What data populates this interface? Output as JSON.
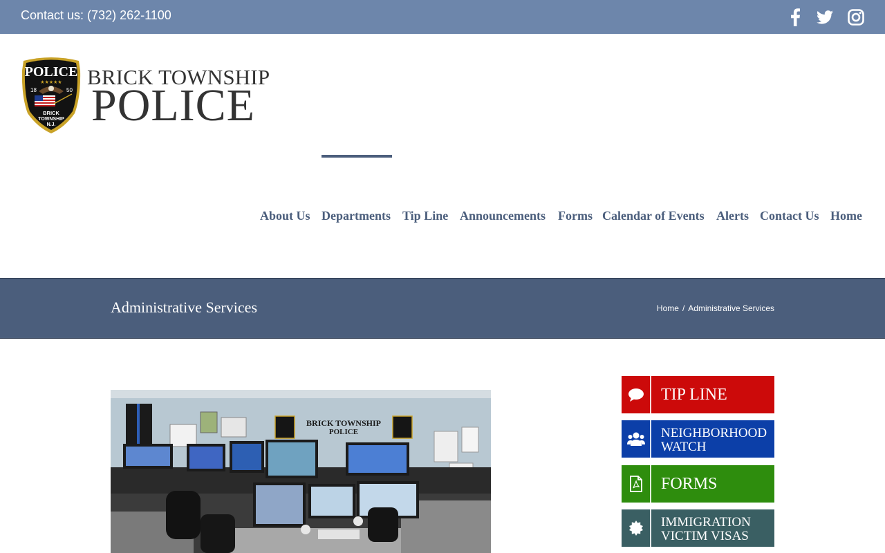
{
  "topbar": {
    "contact": "Contact us: (732) 262-1100",
    "social": [
      "facebook-icon",
      "twitter-icon",
      "instagram-icon"
    ]
  },
  "logo": {
    "badge_text": "POLICE",
    "badge_year_left": "18",
    "badge_year_right": "50",
    "badge_bottom_1": "BRICK",
    "badge_bottom_2": "TOWNSHIP",
    "badge_bottom_3": "N.J.",
    "line1": "BRICK TOWNSHIP",
    "line2": "POLICE"
  },
  "nav": {
    "items": [
      "About Us",
      "Departments",
      "Tip Line",
      "Announcements",
      "Forms",
      "Calendar of Events",
      "Alerts",
      "Contact Us",
      "Home"
    ],
    "active": "Departments"
  },
  "page": {
    "title": "Administrative Services",
    "breadcrumb": [
      "Home",
      "Administrative Services"
    ]
  },
  "photo": {
    "sign_line1": "BRICK TOWNSHIP",
    "sign_line2": "POLICE"
  },
  "sidebar": {
    "buttons": [
      {
        "label": "TIP LINE",
        "color": "#cc0a0a",
        "icon": "chat-bubble-icon"
      },
      {
        "label": "NEIGHBORHOOD WATCH",
        "color": "#0c3fa8",
        "icon": "users-icon"
      },
      {
        "label": "FORMS",
        "color": "#2e8d0d",
        "icon": "pdf-file-icon"
      },
      {
        "label": "IMMIGRATION VICTIM VISAS",
        "color": "#3a5f63",
        "icon": "seal-icon"
      }
    ]
  },
  "colors": {
    "topbar": "#6d86ab",
    "navy": "#4b5e7c"
  }
}
